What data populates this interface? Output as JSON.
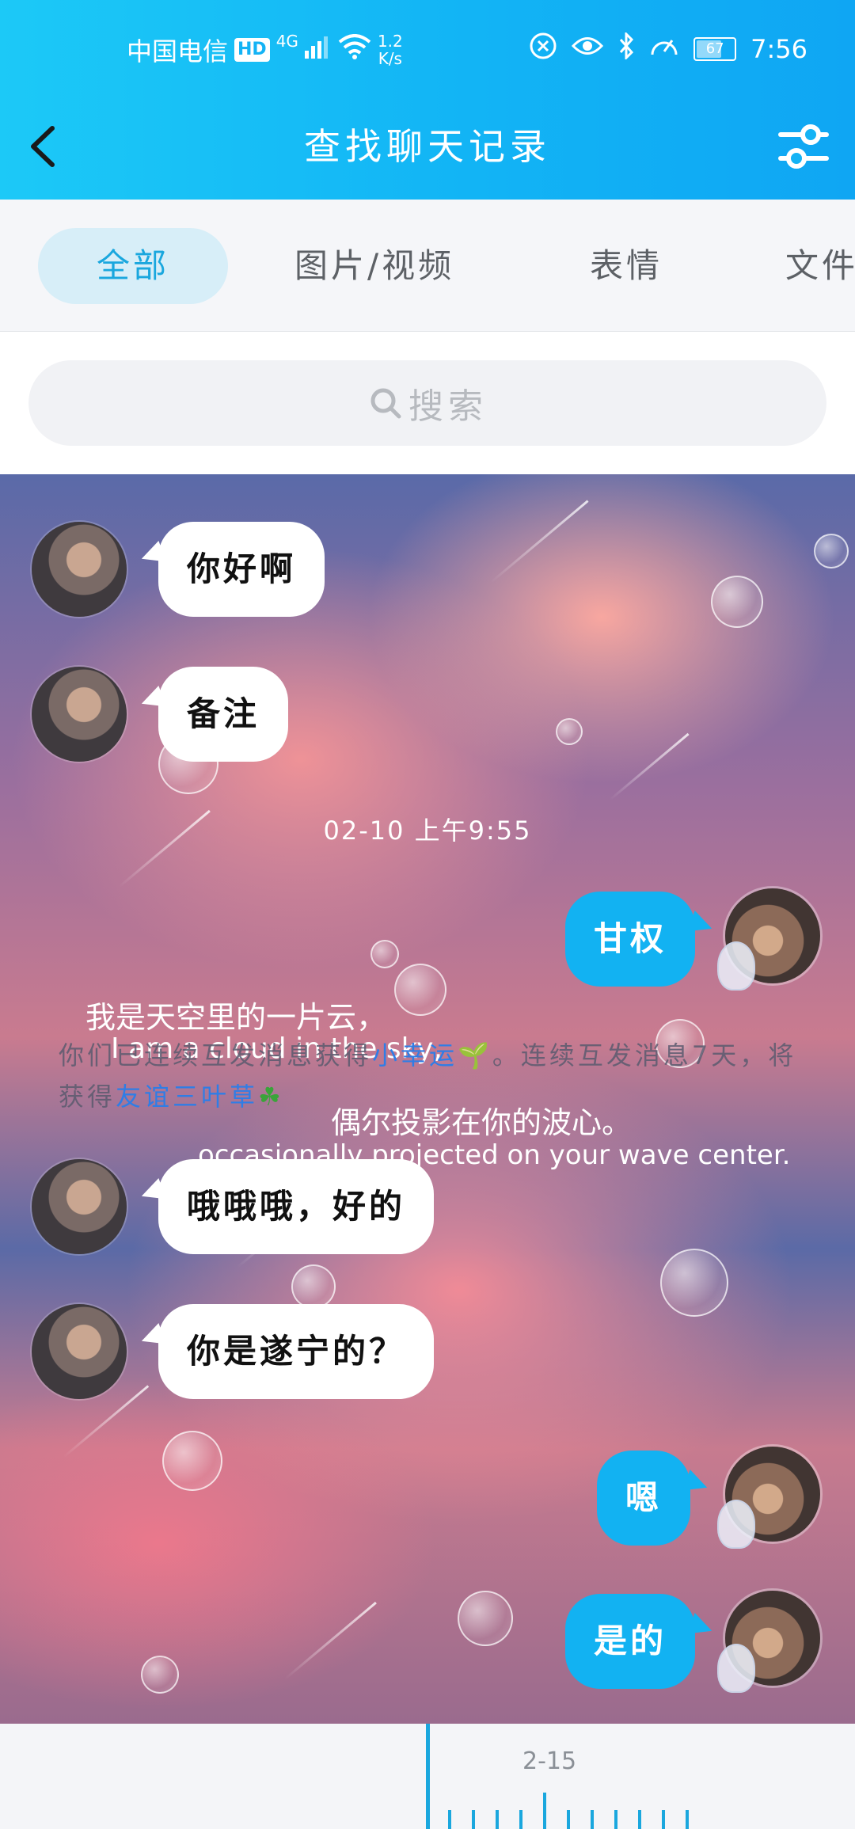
{
  "status_bar": {
    "carrier": "中国电信",
    "hd": "HD",
    "network": "4G",
    "speed_value": "1.2",
    "speed_unit": "K/s",
    "battery": "67",
    "time": "7:56"
  },
  "header": {
    "title": "查找聊天记录"
  },
  "tabs": [
    {
      "label": "全部",
      "active": true
    },
    {
      "label": "图片/视频",
      "active": false
    },
    {
      "label": "表情",
      "active": false
    },
    {
      "label": "文件",
      "active": false
    }
  ],
  "search": {
    "placeholder": "搜索"
  },
  "messages": [
    {
      "side": "in",
      "text": "你好啊"
    },
    {
      "side": "in",
      "text": "备注"
    },
    {
      "side": "out",
      "text": "甘权"
    },
    {
      "side": "in",
      "text": "哦哦哦，好的"
    },
    {
      "side": "in",
      "text": "你是遂宁的？"
    },
    {
      "side": "out",
      "text": "嗯"
    },
    {
      "side": "out",
      "text": "是的"
    }
  ],
  "timestamp": "02-10 上午9:55",
  "background_text": {
    "line1": "我是天空里的一片云，",
    "line2": "I am a cloud in the sky,",
    "line3": "偶尔投影在你的波心。",
    "line4": "occasionally projected on your wave center."
  },
  "notice": {
    "part1": "你们已连续互发消息获得",
    "highlight1": "小幸运",
    "part2": "。连续互发消息7天，将获得",
    "highlight2": "友谊三叶草"
  },
  "timeline": {
    "label": "2-15"
  },
  "colors": {
    "accent": "#12b2f2",
    "header_start": "#1cc9f7",
    "header_end": "#0fa6f3",
    "tab_active_bg": "#d7eef8",
    "tab_active_text": "#1aa7de",
    "link_highlight": "#2f7de6"
  }
}
